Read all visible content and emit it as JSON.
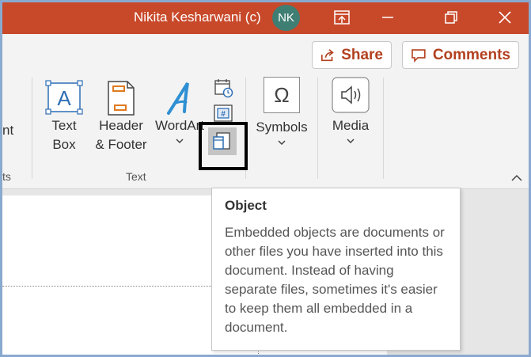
{
  "titlebar": {
    "user_name": "Nikita Kesharwani (c)",
    "avatar_initials": "NK"
  },
  "ribbon": {
    "share_label": "Share",
    "comments_label": "Comments",
    "partial_left_text": "nt",
    "partial_group_label": "ts",
    "text_box": {
      "line1": "Text",
      "line2": "Box"
    },
    "header_footer": {
      "line1": "Header",
      "line2": "& Footer"
    },
    "wordart_label": "WordArt",
    "symbols_label": "Symbols",
    "media_label": "Media",
    "symbol_glyph": "Ω",
    "text_group_label": "Text"
  },
  "tooltip": {
    "title": "Object",
    "body": "Embedded objects are documents or other files you have inserted into this document. Instead of having separate files, sometimes it's easier to keep them all embedded in a document."
  },
  "colors": {
    "titlebar": "#c8492a",
    "accent_text": "#b3401f",
    "avatar": "#3f7e73",
    "highlight": "#000000"
  }
}
